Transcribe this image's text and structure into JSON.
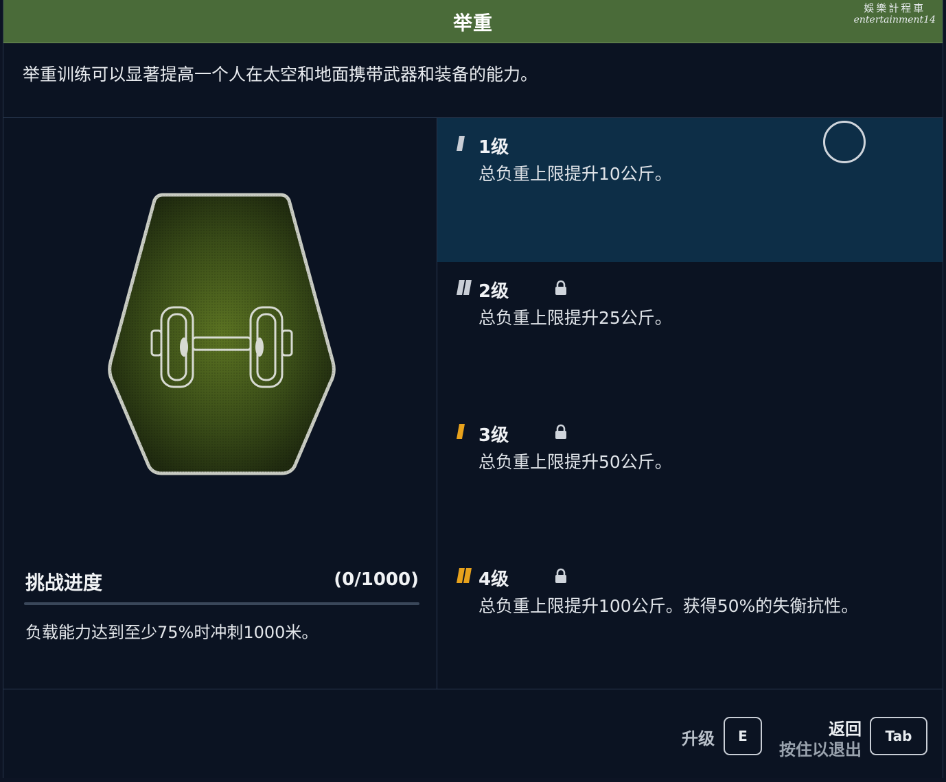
{
  "header": {
    "title": "举重",
    "watermark_line1": "娛樂計程車",
    "watermark_line2": "entertainment14"
  },
  "description": "举重训练可以显著提高一个人在太空和地面携带武器和装备的能力。",
  "badge": {
    "icon": "dumbbell-icon"
  },
  "challenge": {
    "title": "挑战进度",
    "progress_text": "(0/1000)",
    "current": 0,
    "target": 1000,
    "description": "负载能力达到至少75%时冲刺1000米。"
  },
  "tiers": [
    {
      "label": "1级",
      "description": "总负重上限提升10公斤。",
      "locked": false,
      "selected": true,
      "marker_color": "#c9ced6",
      "marker_count": 1
    },
    {
      "label": "2级",
      "description": "总负重上限提升25公斤。",
      "locked": true,
      "selected": false,
      "marker_color": "#c9ced6",
      "marker_count": 2
    },
    {
      "label": "3级",
      "description": "总负重上限提升50公斤。",
      "locked": true,
      "selected": false,
      "marker_color": "#e8a21c",
      "marker_count": 1
    },
    {
      "label": "4级",
      "description": "总负重上限提升100公斤。获得50%的失衡抗性。",
      "locked": true,
      "selected": false,
      "marker_color": "#e8a21c",
      "marker_count": 2
    }
  ],
  "footer": {
    "upgrade_label": "升级",
    "upgrade_key": "E",
    "back_label": "返回",
    "hold_label": "按住以退出",
    "back_key": "Tab"
  },
  "colors": {
    "title_bar": "#4a6b39",
    "selected_tier": "#0d2e47",
    "background": "#0b1322",
    "accent_orange": "#e8a21c"
  }
}
